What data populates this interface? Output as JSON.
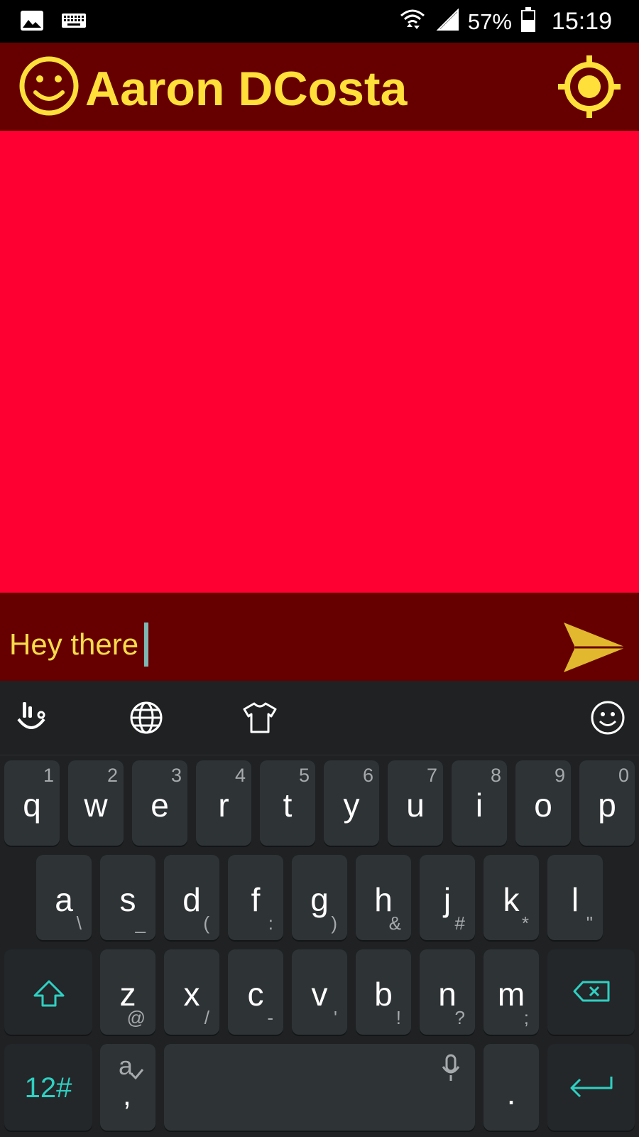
{
  "status": {
    "battery": "57%",
    "time": "15:19",
    "icons": [
      "image-icon",
      "keyboard-icon",
      "wifi-icon",
      "signal-icon",
      "battery-icon"
    ]
  },
  "appbar": {
    "title": "Aaron DCosta",
    "title_color": "#FFE03A",
    "background": "#660000"
  },
  "chat": {
    "background": "#FF0033"
  },
  "composer": {
    "text": "Hey there",
    "text_color": "#F6DB4B"
  },
  "keyboard": {
    "toolbar_icons": [
      "touchpal-logo-icon",
      "globe-icon",
      "tshirt-theme-icon",
      "emoji-icon"
    ],
    "row1": [
      {
        "k": "q",
        "n": "1"
      },
      {
        "k": "w",
        "n": "2"
      },
      {
        "k": "e",
        "n": "3"
      },
      {
        "k": "r",
        "n": "4"
      },
      {
        "k": "t",
        "n": "5"
      },
      {
        "k": "y",
        "n": "6"
      },
      {
        "k": "u",
        "n": "7"
      },
      {
        "k": "i",
        "n": "8"
      },
      {
        "k": "o",
        "n": "9"
      },
      {
        "k": "p",
        "n": "0"
      }
    ],
    "row2": [
      {
        "k": "a",
        "s": "\\"
      },
      {
        "k": "s",
        "s": "_"
      },
      {
        "k": "d",
        "s": "("
      },
      {
        "k": "f",
        "s": ":"
      },
      {
        "k": "g",
        "s": ")"
      },
      {
        "k": "h",
        "s": "&"
      },
      {
        "k": "j",
        "s": "#"
      },
      {
        "k": "k",
        "s": "*"
      },
      {
        "k": "l",
        "s": "\""
      }
    ],
    "row3": [
      {
        "k": "z",
        "s": "@"
      },
      {
        "k": "x",
        "s": "/"
      },
      {
        "k": "c",
        "s": "-"
      },
      {
        "k": "v",
        "s": "'"
      },
      {
        "k": "b",
        "s": "!"
      },
      {
        "k": "n",
        "s": "?"
      },
      {
        "k": "m",
        "s": ";"
      }
    ],
    "row4": {
      "numbers_label": "12#",
      "lang_top": "a",
      "lang_bottom": ",",
      "period": "."
    },
    "accent": "#2fd0c2"
  }
}
